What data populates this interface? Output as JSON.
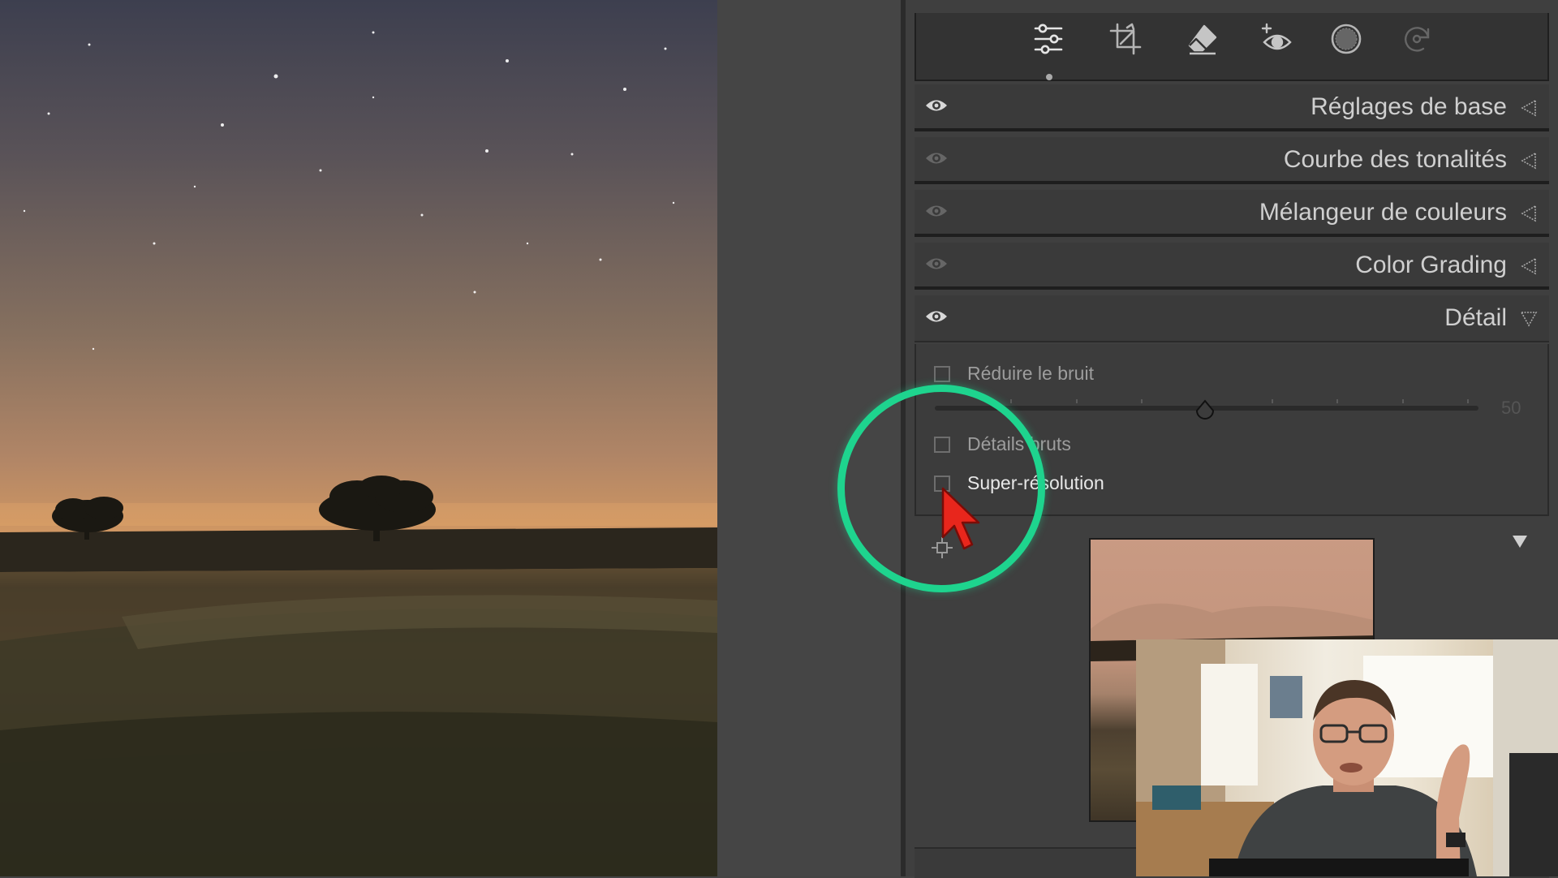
{
  "toolbar": {
    "tools": [
      "edit-sliders-icon",
      "crop-icon",
      "eraser-icon",
      "red-eye-icon",
      "masking-icon",
      "presets-icon"
    ],
    "active_tool": "edit-sliders-icon"
  },
  "sections": [
    {
      "title": "Réglages de base",
      "visible": true,
      "expanded": false
    },
    {
      "title": "Courbe des tonalités",
      "visible": false,
      "expanded": false
    },
    {
      "title": "Mélangeur de couleurs",
      "visible": false,
      "expanded": false
    },
    {
      "title": "Color Grading",
      "visible": false,
      "expanded": false
    },
    {
      "title": "Détail",
      "visible": true,
      "expanded": true
    }
  ],
  "detail": {
    "reduce_noise": {
      "label": "Réduire le bruit",
      "checked": false,
      "slider_value": "50"
    },
    "raw_details": {
      "label": "Détails bruts",
      "checked": false
    },
    "super_resolution": {
      "label": "Super-résolution",
      "checked": false
    }
  },
  "colors": {
    "highlight_ring": "#1ed48e",
    "cursor": "#e8261c",
    "panel_bg": "#3f3f3f"
  }
}
